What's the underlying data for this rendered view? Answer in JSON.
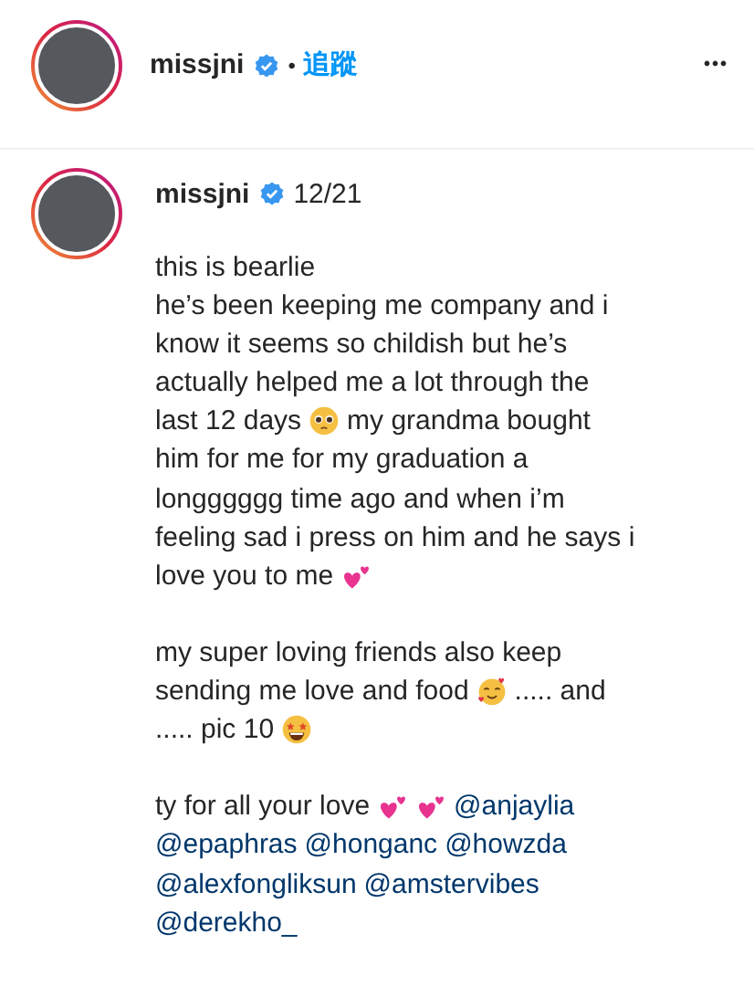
{
  "header": {
    "username": "missjni",
    "verified": true,
    "separator": "•",
    "follow": "追蹤",
    "more": "•••"
  },
  "post": {
    "username": "missjni",
    "verified": true,
    "date": "12/21",
    "caption": [
      [
        [
          {
            "kind": "text",
            "text": "this is bearlie"
          }
        ],
        [
          {
            "kind": "text",
            "text": "he’s been keeping me company and i"
          }
        ],
        [
          {
            "kind": "text",
            "text": "know it seems so childish but he’s"
          }
        ],
        [
          {
            "kind": "text",
            "text": "actually helped me a lot through the"
          }
        ],
        [
          {
            "kind": "text",
            "text": "last 12 days"
          },
          {
            "kind": "pleading"
          },
          {
            "kind": "text",
            "text": "my grandma bought"
          }
        ],
        [
          {
            "kind": "text",
            "text": "him for me for my graduation a"
          }
        ],
        [
          {
            "kind": "text",
            "text": "longggggg time ago and when i’m"
          }
        ],
        [
          {
            "kind": "text",
            "text": "feeling sad i press on him and he says i"
          }
        ],
        [
          {
            "kind": "text",
            "text": "love you to me"
          },
          {
            "kind": "hearts"
          }
        ]
      ],
      [
        [
          {
            "kind": "text",
            "text": "my super loving friends also keep"
          }
        ],
        [
          {
            "kind": "text",
            "text": "sending me love and food"
          },
          {
            "kind": "smiling-hearts"
          },
          {
            "kind": "text",
            "text": "..... and"
          }
        ],
        [
          {
            "kind": "text",
            "text": "..... pic 10"
          },
          {
            "kind": "star-struck"
          }
        ]
      ],
      [
        [
          {
            "kind": "text",
            "text": "ty for all your love"
          },
          {
            "kind": "hearts"
          },
          {
            "kind": "hearts"
          },
          {
            "kind": "mention",
            "text": "@anjaylia"
          }
        ],
        [
          {
            "kind": "mention",
            "text": "@epaphras"
          },
          {
            "kind": "mention",
            "text": "@honganc"
          },
          {
            "kind": "mention",
            "text": "@howzda"
          }
        ],
        [
          {
            "kind": "mention",
            "text": "@alexfongliksun"
          },
          {
            "kind": "mention",
            "text": "@amstervibes"
          }
        ],
        [
          {
            "kind": "mention",
            "text": "@derekho_"
          }
        ]
      ]
    ]
  }
}
